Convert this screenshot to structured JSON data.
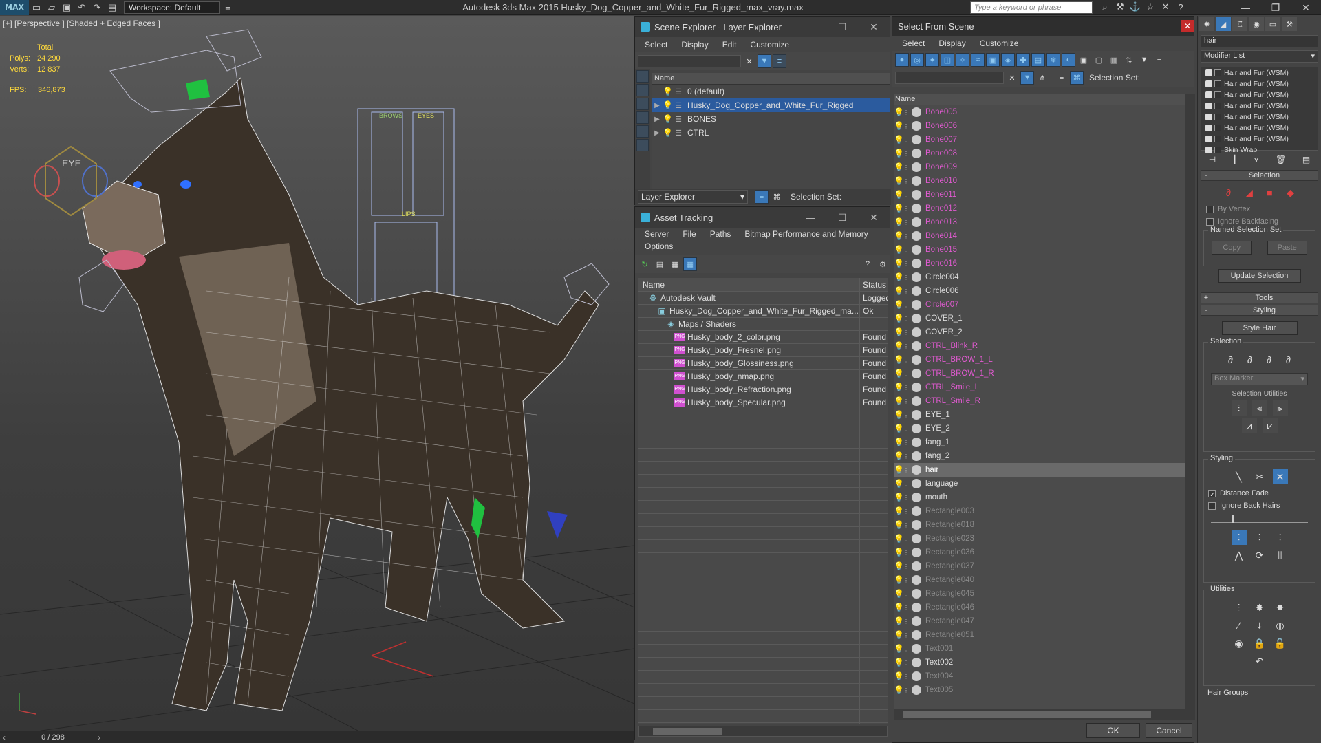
{
  "app": {
    "title": "Autodesk 3ds Max  2015    Husky_Dog_Copper_and_White_Fur_Rigged_max_vray.max",
    "logo": "MAX",
    "workspace": "Workspace: Default",
    "search_placeholder": "Type a keyword or phrase"
  },
  "viewport": {
    "label": "[+] [Perspective ] [Shaded + Edged Faces ]",
    "stats_header": "Total",
    "stats": [
      {
        "k": "Polys:",
        "v": "24 290"
      },
      {
        "k": "Verts:",
        "v": "12 837"
      }
    ],
    "fps_label": "FPS:",
    "fps": "346,873",
    "ctrl_labels": {
      "eye": "EYE",
      "brows": "BROWS",
      "eyes": "EYES",
      "lips": "LIPS"
    }
  },
  "timeline": {
    "frame": "0 / 298"
  },
  "scene_explorer": {
    "title": "Scene Explorer - Layer Explorer",
    "menu": [
      "Select",
      "Display",
      "Edit",
      "Customize"
    ],
    "col_name": "Name",
    "rows": [
      {
        "label": "0 (default)",
        "expand": false,
        "selected": false
      },
      {
        "label": "Husky_Dog_Copper_and_White_Fur_Rigged",
        "expand": true,
        "selected": true
      },
      {
        "label": "BONES",
        "expand": true,
        "selected": false
      },
      {
        "label": "CTRL",
        "expand": true,
        "selected": false
      }
    ],
    "explorer_type": "Layer Explorer",
    "selection_set": "Selection Set:"
  },
  "asset_tracking": {
    "title": "Asset Tracking",
    "menu": [
      "Server",
      "File",
      "Paths",
      "Bitmap Performance and Memory"
    ],
    "menu2": [
      "Options"
    ],
    "col_name": "Name",
    "col_status": "Status",
    "rows": [
      {
        "name": "Autodesk Vault",
        "status": "Logged",
        "indent": 1,
        "kind": "vault"
      },
      {
        "name": "Husky_Dog_Copper_and_White_Fur_Rigged_ma...",
        "status": "Ok",
        "indent": 2,
        "kind": "file"
      },
      {
        "name": "Maps / Shaders",
        "status": "",
        "indent": 3,
        "kind": "maps"
      },
      {
        "name": "Husky_body_2_color.png",
        "status": "Found",
        "indent": 4,
        "kind": "png"
      },
      {
        "name": "Husky_body_Fresnel.png",
        "status": "Found",
        "indent": 4,
        "kind": "png"
      },
      {
        "name": "Husky_body_Glossiness.png",
        "status": "Found",
        "indent": 4,
        "kind": "png"
      },
      {
        "name": "Husky_body_nmap.png",
        "status": "Found",
        "indent": 4,
        "kind": "png"
      },
      {
        "name": "Husky_body_Refraction.png",
        "status": "Found",
        "indent": 4,
        "kind": "png"
      },
      {
        "name": "Husky_body_Specular.png",
        "status": "Found",
        "indent": 4,
        "kind": "png"
      }
    ],
    "png_badge": "PNG"
  },
  "select_from_scene": {
    "title": "Select From Scene",
    "menu": [
      "Select",
      "Display",
      "Customize"
    ],
    "selection_set": "Selection Set:",
    "col_name": "Name",
    "items": [
      {
        "name": "Bone005",
        "color": "#e05ad0",
        "selected": false
      },
      {
        "name": "Bone006",
        "color": "#e05ad0",
        "selected": false
      },
      {
        "name": "Bone007",
        "color": "#e05ad0",
        "selected": false
      },
      {
        "name": "Bone008",
        "color": "#e05ad0",
        "selected": false
      },
      {
        "name": "Bone009",
        "color": "#e05ad0",
        "selected": false
      },
      {
        "name": "Bone010",
        "color": "#e05ad0",
        "selected": false
      },
      {
        "name": "Bone011",
        "color": "#e05ad0",
        "selected": false
      },
      {
        "name": "Bone012",
        "color": "#e05ad0",
        "selected": false
      },
      {
        "name": "Bone013",
        "color": "#e05ad0",
        "selected": false
      },
      {
        "name": "Bone014",
        "color": "#e05ad0",
        "selected": false
      },
      {
        "name": "Bone015",
        "color": "#e05ad0",
        "selected": false
      },
      {
        "name": "Bone016",
        "color": "#e05ad0",
        "selected": false
      },
      {
        "name": "Circle004",
        "color": "#dddddd",
        "selected": false
      },
      {
        "name": "Circle006",
        "color": "#dddddd",
        "selected": false
      },
      {
        "name": "Circle007",
        "color": "#e05ad0",
        "selected": false
      },
      {
        "name": "COVER_1",
        "color": "#dddddd",
        "selected": false
      },
      {
        "name": "COVER_2",
        "color": "#dddddd",
        "selected": false
      },
      {
        "name": "CTRL_Blink_R",
        "color": "#e05ad0",
        "selected": false
      },
      {
        "name": "CTRL_BROW_1_L",
        "color": "#e05ad0",
        "selected": false
      },
      {
        "name": "CTRL_BROW_1_R",
        "color": "#e05ad0",
        "selected": false
      },
      {
        "name": "CTRL_Smile_L",
        "color": "#e05ad0",
        "selected": false
      },
      {
        "name": "CTRL_Smile_R",
        "color": "#e05ad0",
        "selected": false
      },
      {
        "name": "EYE_1",
        "color": "#dddddd",
        "selected": false
      },
      {
        "name": "EYE_2",
        "color": "#dddddd",
        "selected": false
      },
      {
        "name": "fang_1",
        "color": "#dddddd",
        "selected": false
      },
      {
        "name": "fang_2",
        "color": "#dddddd",
        "selected": false
      },
      {
        "name": "hair",
        "color": "#ffffff",
        "selected": true
      },
      {
        "name": "language",
        "color": "#dddddd",
        "selected": false
      },
      {
        "name": "mouth",
        "color": "#dddddd",
        "selected": false
      },
      {
        "name": "Rectangle003",
        "color": "#8a8a8a",
        "selected": false
      },
      {
        "name": "Rectangle018",
        "color": "#8a8a8a",
        "selected": false
      },
      {
        "name": "Rectangle023",
        "color": "#8a8a8a",
        "selected": false
      },
      {
        "name": "Rectangle036",
        "color": "#8a8a8a",
        "selected": false
      },
      {
        "name": "Rectangle037",
        "color": "#8a8a8a",
        "selected": false
      },
      {
        "name": "Rectangle040",
        "color": "#8a8a8a",
        "selected": false
      },
      {
        "name": "Rectangle045",
        "color": "#8a8a8a",
        "selected": false
      },
      {
        "name": "Rectangle046",
        "color": "#8a8a8a",
        "selected": false
      },
      {
        "name": "Rectangle047",
        "color": "#8a8a8a",
        "selected": false
      },
      {
        "name": "Rectangle051",
        "color": "#8a8a8a",
        "selected": false
      },
      {
        "name": "Text001",
        "color": "#8a8a8a",
        "selected": false
      },
      {
        "name": "Text002",
        "color": "#dddddd",
        "selected": false
      },
      {
        "name": "Text004",
        "color": "#8a8a8a",
        "selected": false
      },
      {
        "name": "Text005",
        "color": "#8a8a8a",
        "selected": false
      }
    ],
    "ok": "OK",
    "cancel": "Cancel"
  },
  "command_panel": {
    "object_name": "hair",
    "modifier_list": "Modifier List",
    "stack": [
      "Hair and Fur (WSM)",
      "Hair and Fur (WSM)",
      "Hair and Fur (WSM)",
      "Hair and Fur (WSM)",
      "Hair and Fur (WSM)",
      "Hair and Fur (WSM)",
      "Hair and Fur (WSM)",
      "Skin Wrap"
    ],
    "selection_rollout": "Selection",
    "by_vertex": "By Vertex",
    "ignore_backfacing": "Ignore Backfacing",
    "named_selection_set": "Named Selection Set",
    "copy": "Copy",
    "paste": "Paste",
    "update_selection": "Update Selection",
    "tools_rollout": "Tools",
    "styling_rollout": "Styling",
    "style_hair": "Style Hair",
    "grp_selection": "Selection",
    "box_marker": "Box Marker",
    "selection_utilities": "Selection Utilities",
    "grp_styling": "Styling",
    "distance_fade": "Distance Fade",
    "ignore_back_hairs": "Ignore Back Hairs",
    "grp_utilities": "Utilities",
    "hair_groups": "Hair Groups"
  }
}
